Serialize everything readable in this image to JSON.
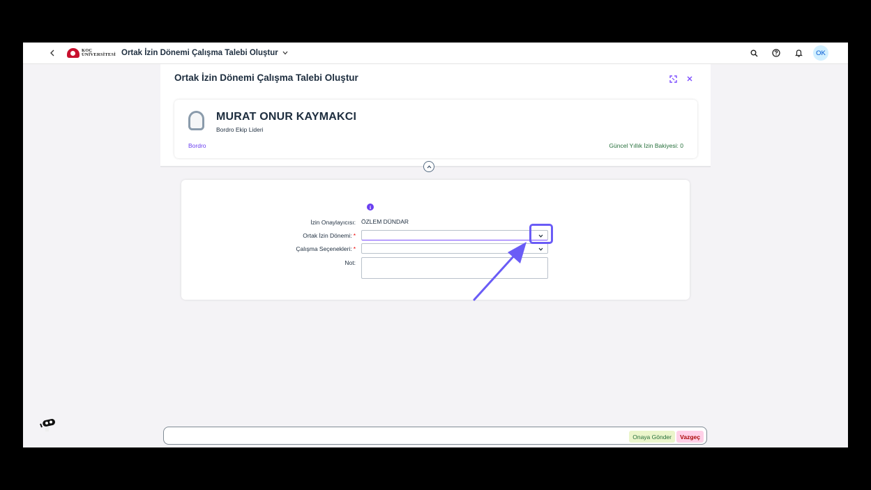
{
  "shell": {
    "back_icon": "chevron-left-icon",
    "logo_line1": "KOÇ",
    "logo_line2": "ÜNİVERSİTESİ",
    "app_title": "Ortak İzin Dönemi Çalışma Talebi Oluştur",
    "user_initials": "OK"
  },
  "dialog": {
    "title": "Ortak İzin Dönemi Çalışma Talebi Oluştur"
  },
  "employee": {
    "name": "MURAT ONUR KAYMAKCI",
    "role": "Bordro Ekip Lideri",
    "department": "Bordro",
    "balance": "Güncel Yıllık İzin Bakiyesi: 0"
  },
  "form": {
    "approver_label": "İzin Onaylayıcısı:",
    "approver_value": "ÖZLEM DÜNDAR",
    "period_label": "Ortak İzin Dönemi:",
    "options_label": "Çalışma Seçenekleri:",
    "note_label": "Not:",
    "required_mark": "*"
  },
  "footer": {
    "submit_label": "Onaya Gönder",
    "cancel_label": "Vazgeç"
  },
  "colors": {
    "accent": "#7c4dff",
    "annotation": "#6a5cf6",
    "submit_bg": "#ebf5cb",
    "cancel_bg": "#ffd0e7"
  }
}
